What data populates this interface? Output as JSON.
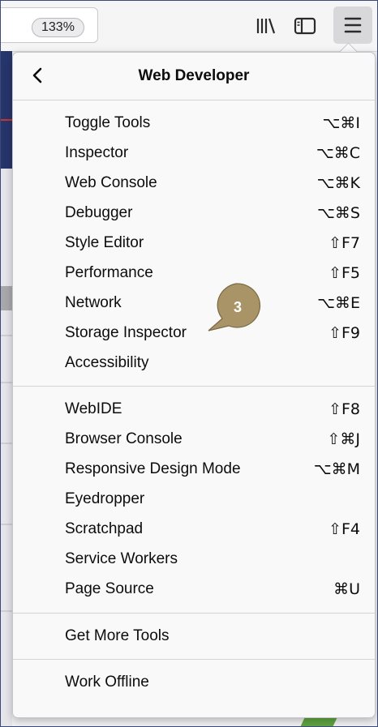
{
  "toolbar": {
    "zoom_level": "133%",
    "icons": [
      "library-icon",
      "sidebar-icon",
      "hamburger-menu-icon"
    ]
  },
  "panel": {
    "title": "Web Developer",
    "back_icon": "chevron-left-icon",
    "group1": [
      {
        "label": "Toggle Tools",
        "shortcut": "⌥⌘I"
      },
      {
        "label": "Inspector",
        "shortcut": "⌥⌘C"
      },
      {
        "label": "Web Console",
        "shortcut": "⌥⌘K"
      },
      {
        "label": "Debugger",
        "shortcut": "⌥⌘S"
      },
      {
        "label": "Style Editor",
        "shortcut": "⇧F7"
      },
      {
        "label": "Performance",
        "shortcut": "⇧F5"
      },
      {
        "label": "Network",
        "shortcut": "⌥⌘E"
      },
      {
        "label": "Storage Inspector",
        "shortcut": "⇧F9"
      },
      {
        "label": "Accessibility",
        "shortcut": ""
      }
    ],
    "group2": [
      {
        "label": "WebIDE",
        "shortcut": "⇧F8"
      },
      {
        "label": "Browser Console",
        "shortcut": "⇧⌘J"
      },
      {
        "label": "Responsive Design Mode",
        "shortcut": "⌥⌘M"
      },
      {
        "label": "Eyedropper",
        "shortcut": ""
      },
      {
        "label": "Scratchpad",
        "shortcut": "⇧F4"
      },
      {
        "label": "Service Workers",
        "shortcut": ""
      },
      {
        "label": "Page Source",
        "shortcut": "⌘U"
      }
    ],
    "group3": [
      {
        "label": "Get More Tools",
        "shortcut": ""
      }
    ],
    "group4": [
      {
        "label": "Work Offline",
        "shortcut": ""
      }
    ]
  },
  "callout": {
    "label": "3",
    "color": "#a89466"
  }
}
